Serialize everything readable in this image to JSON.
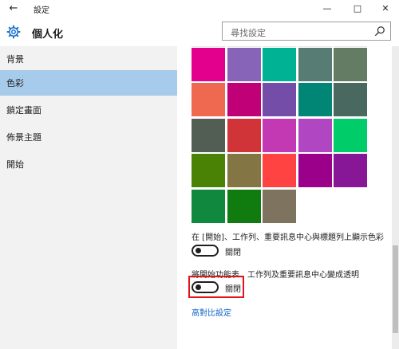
{
  "window": {
    "app_title": "設定",
    "back_icon": "arrow-left-icon",
    "controls": [
      "minimize-icon",
      "maximize-icon",
      "close-icon"
    ]
  },
  "header": {
    "title": "個人化",
    "icon": "gear-icon",
    "search_placeholder": "尋找設定"
  },
  "sidebar": {
    "items": [
      {
        "label": "背景",
        "active": false
      },
      {
        "label": "色彩",
        "active": true
      },
      {
        "label": "鎖定畫面",
        "active": false
      },
      {
        "label": "佈景主題",
        "active": false
      },
      {
        "label": "開始",
        "active": false
      }
    ]
  },
  "colors": {
    "swatches": [
      "#e3008c",
      "#8764b8",
      "#00b294",
      "#567c73",
      "#647c64",
      "#ef6950",
      "#bf0077",
      "#744da9",
      "#018574",
      "#486860",
      "#525e54",
      "#d13438",
      "#c239b3",
      "#b146c2",
      "#00cc6a",
      "#498205",
      "#847545",
      "#ff4343",
      "#9a0089",
      "#881798",
      "#10893e",
      "#107c10",
      "#7e735f"
    ],
    "accent": "#0b63c7",
    "highlight": "#e3151a"
  },
  "settings": {
    "show_color_label": "在 [開始]、工作列、重要訊息中心與標題列上顯示色彩",
    "show_color_state": "關閉",
    "transparency_label": "將開始功能表、工作列及重要訊息中心變成透明",
    "transparency_state": "關閉",
    "high_contrast_link": "高對比設定"
  }
}
